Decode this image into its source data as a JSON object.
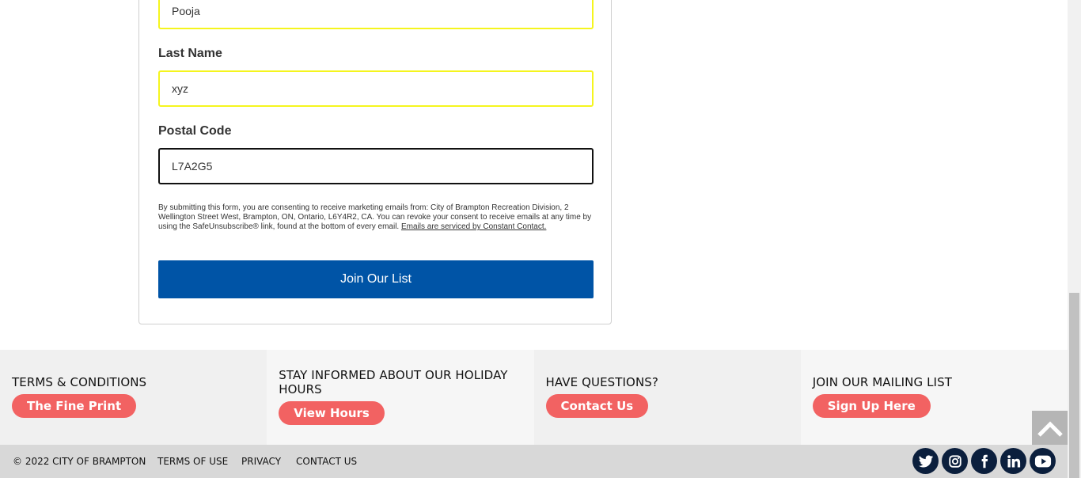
{
  "form": {
    "first_name_value": "Pooja",
    "last_name_label": "Last Name",
    "last_name_value": "xyz",
    "postal_code_label": "Postal Code",
    "postal_code_value": "L7A2G5",
    "consent_text": "By submitting this form, you are consenting to receive marketing emails from: City of Brampton Recreation Division, 2 Wellington Street West, Brampton, ON, Ontario, L6Y4R2, CA. You can revoke your consent to receive emails at any time by using the SafeUnsubscribe® link, found at the bottom of every email.",
    "consent_link": "Emails are serviced by Constant Contact.",
    "submit_label": "Join Our List"
  },
  "footer": {
    "columns": [
      {
        "heading": "TERMS & CONDITIONS",
        "button": "The Fine Print"
      },
      {
        "heading": "STAY INFORMED ABOUT OUR HOLIDAY HOURS",
        "button": "View Hours"
      },
      {
        "heading": "HAVE QUESTIONS?",
        "button": "Contact Us"
      },
      {
        "heading": "JOIN OUR MAILING LIST",
        "button": "Sign Up Here"
      }
    ],
    "copyright": "© 2022 CITY OF BRAMPTON",
    "links": [
      "TERMS OF USE",
      "PRIVACY",
      "CONTACT US"
    ],
    "social_icons": [
      "twitter-icon",
      "instagram-icon",
      "facebook-icon",
      "linkedin-icon",
      "youtube-icon"
    ]
  },
  "colors": {
    "primary_button": "#0054a6",
    "pill_button": "#f26262",
    "input_highlight": "#f5f51e",
    "social_bg": "#0b1f3d"
  }
}
